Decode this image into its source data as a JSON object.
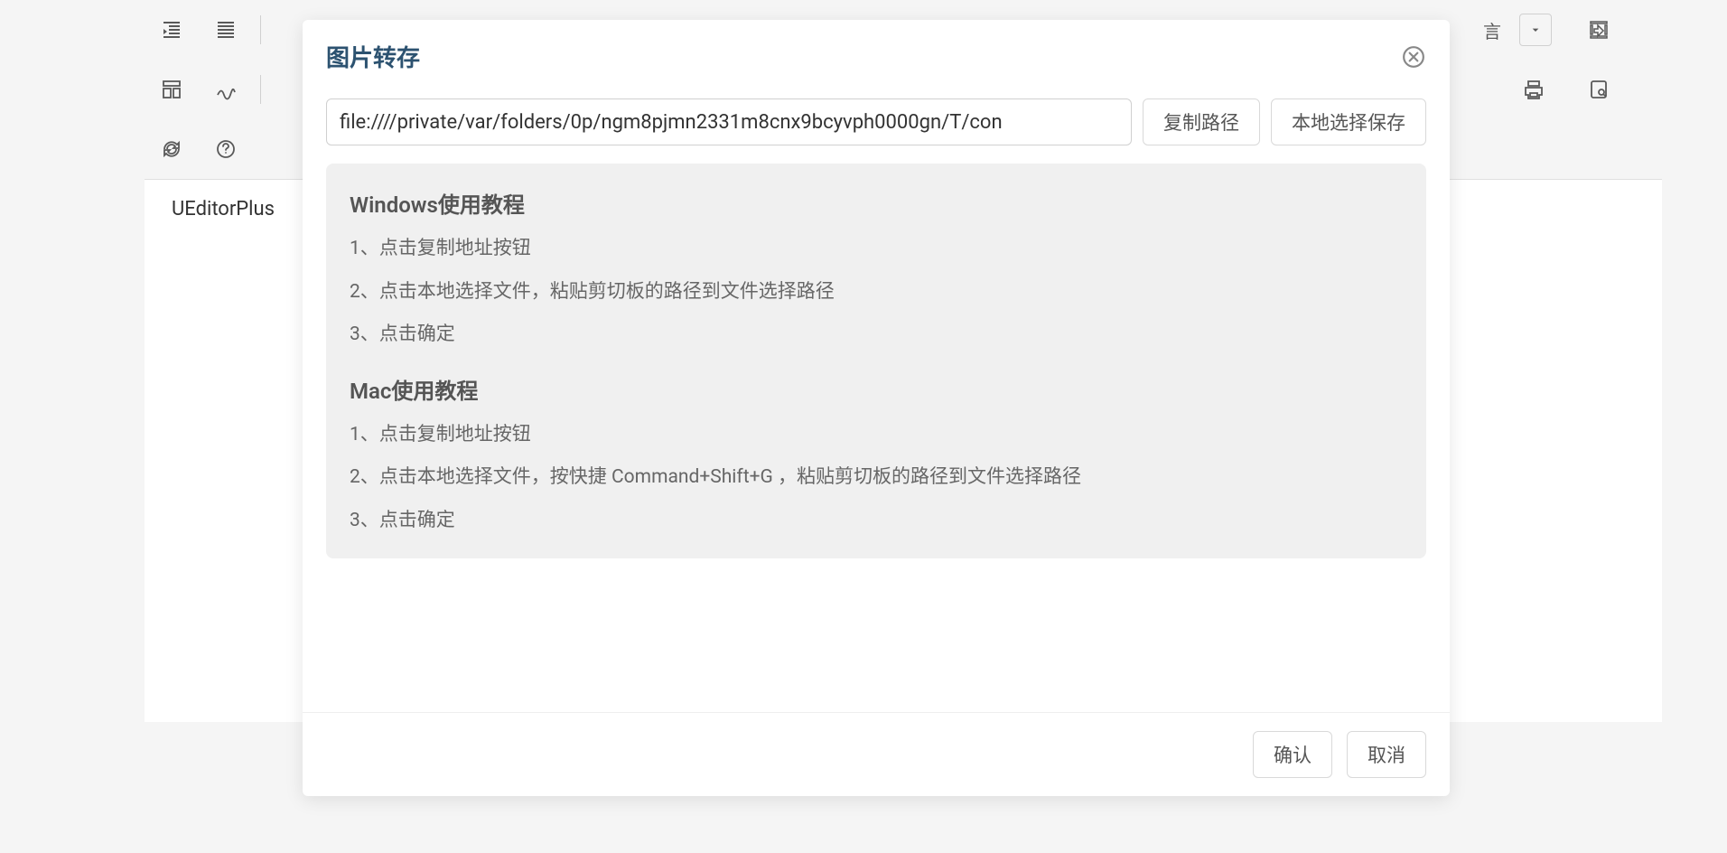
{
  "editor": {
    "content_text": "UEditorPlus ",
    "toolbar": {
      "lang_dropdown_char": "言"
    }
  },
  "dialog": {
    "title": "图片转存",
    "path_input_value": "file:////private/var/folders/0p/ngm8pjmn2331m8cnx9bcyvph0000gn/T/con",
    "copy_path_btn": "复制路径",
    "local_save_btn": "本地选择保存",
    "tutorial": {
      "windows_heading": "Windows使用教程",
      "windows_steps": [
        "1、点击复制地址按钮",
        "2、点击本地选择文件，粘贴剪切板的路径到文件选择路径",
        "3、点击确定"
      ],
      "mac_heading": "Mac使用教程",
      "mac_steps": [
        "1、点击复制地址按钮",
        "2、点击本地选择文件，按快捷 Command+Shift+G ，粘贴剪切板的路径到文件选择路径",
        "3、点击确定"
      ]
    },
    "confirm_btn": "确认",
    "cancel_btn": "取消"
  }
}
